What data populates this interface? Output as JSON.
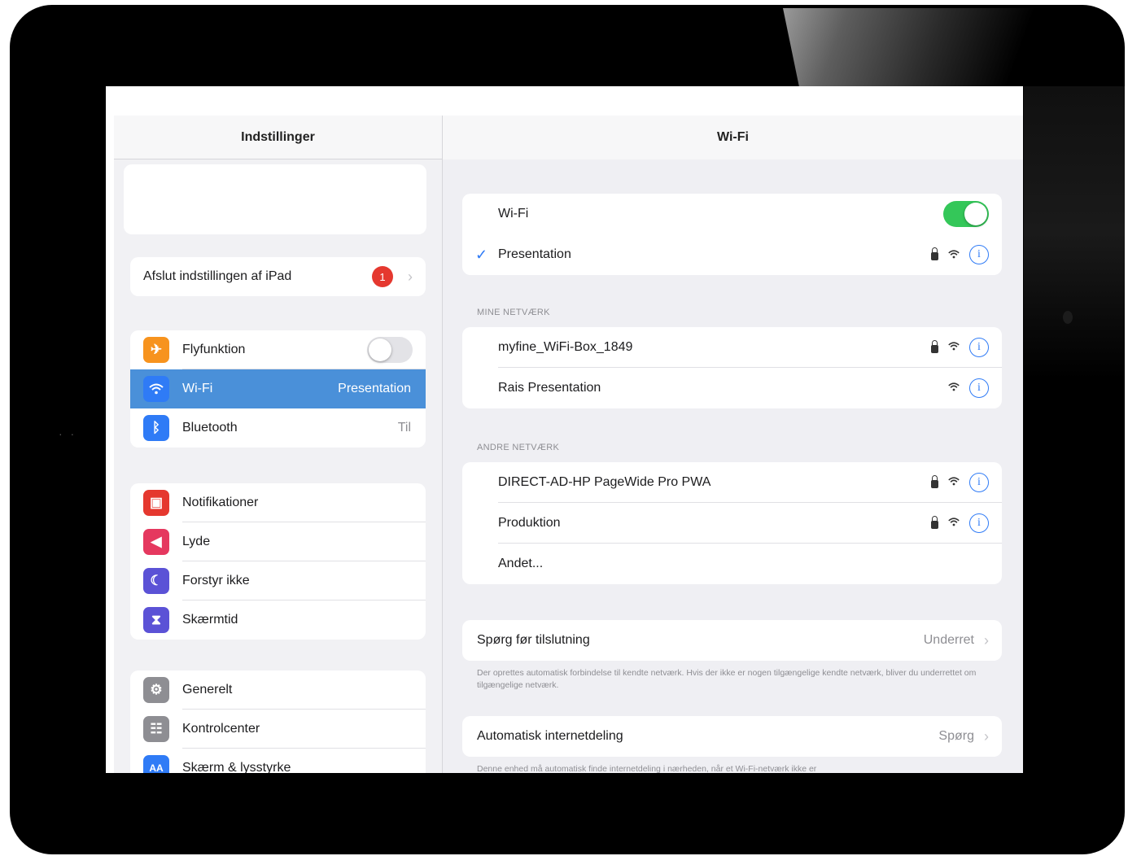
{
  "sidebar": {
    "title": "Indstillinger",
    "setup_row": {
      "label": "Afslut indstillingen af iPad",
      "badge": "1"
    },
    "connectivity": [
      {
        "key": "airplane",
        "label": "Flyfunktion",
        "icon": "airplane-icon",
        "color": "#f7931e",
        "toggle": "off"
      },
      {
        "key": "wifi",
        "label": "Wi-Fi",
        "icon": "wifi-icon",
        "color": "#2f7bf6",
        "value": "Presentation",
        "selected": true
      },
      {
        "key": "bluetooth",
        "label": "Bluetooth",
        "icon": "bluetooth-icon",
        "color": "#2f7bf6",
        "value": "Til"
      }
    ],
    "notifications": [
      {
        "label": "Notifikationer",
        "icon": "notifications-icon",
        "color": "#e5382f"
      },
      {
        "label": "Lyde",
        "icon": "sounds-icon",
        "color": "#e5385f"
      },
      {
        "label": "Forstyr ikke",
        "icon": "moon-icon",
        "color": "#5b52d6"
      },
      {
        "label": "Skærmtid",
        "icon": "hourglass-icon",
        "color": "#5b52d6"
      }
    ],
    "general": [
      {
        "label": "Generelt",
        "icon": "gear-icon",
        "color": "#8e8e93"
      },
      {
        "label": "Kontrolcenter",
        "icon": "control-center-icon",
        "color": "#8e8e93"
      },
      {
        "label": "Skærm & lysstyrke",
        "icon": "display-icon",
        "color": "#2f7bf6",
        "glyph": "AA"
      }
    ]
  },
  "detail": {
    "title": "Wi-Fi",
    "wifi_row": {
      "label": "Wi-Fi",
      "toggle": "on"
    },
    "connected_network": {
      "label": "Presentation",
      "check": "✓"
    },
    "my_networks_title": "MINE NETVÆRK",
    "my_networks": [
      {
        "label": "myfine_WiFi-Box_1849",
        "locked": true
      },
      {
        "label": "Rais Presentation",
        "locked": false
      }
    ],
    "other_networks_title": "ANDRE NETVÆRK",
    "other_networks": [
      {
        "label": "DIRECT-AD-HP PageWide Pro PWA",
        "locked": true
      },
      {
        "label": "Produktion",
        "locked": true
      }
    ],
    "other_label": "Andet...",
    "ask_to_join": {
      "label": "Spørg før tilslutning",
      "value": "Underret"
    },
    "ask_to_join_note": "Der oprettes automatisk forbindelse til kendte netværk. Hvis der ikke er nogen tilgængelige kendte netværk, bliver du underrettet om tilgængelige netværk.",
    "auto_hotspot": {
      "label": "Automatisk internetdeling",
      "value": "Spørg"
    },
    "auto_hotspot_note": "Denne enhed må automatisk finde internetdeling i nærheden, når et Wi-Fi-netværk ikke er"
  }
}
